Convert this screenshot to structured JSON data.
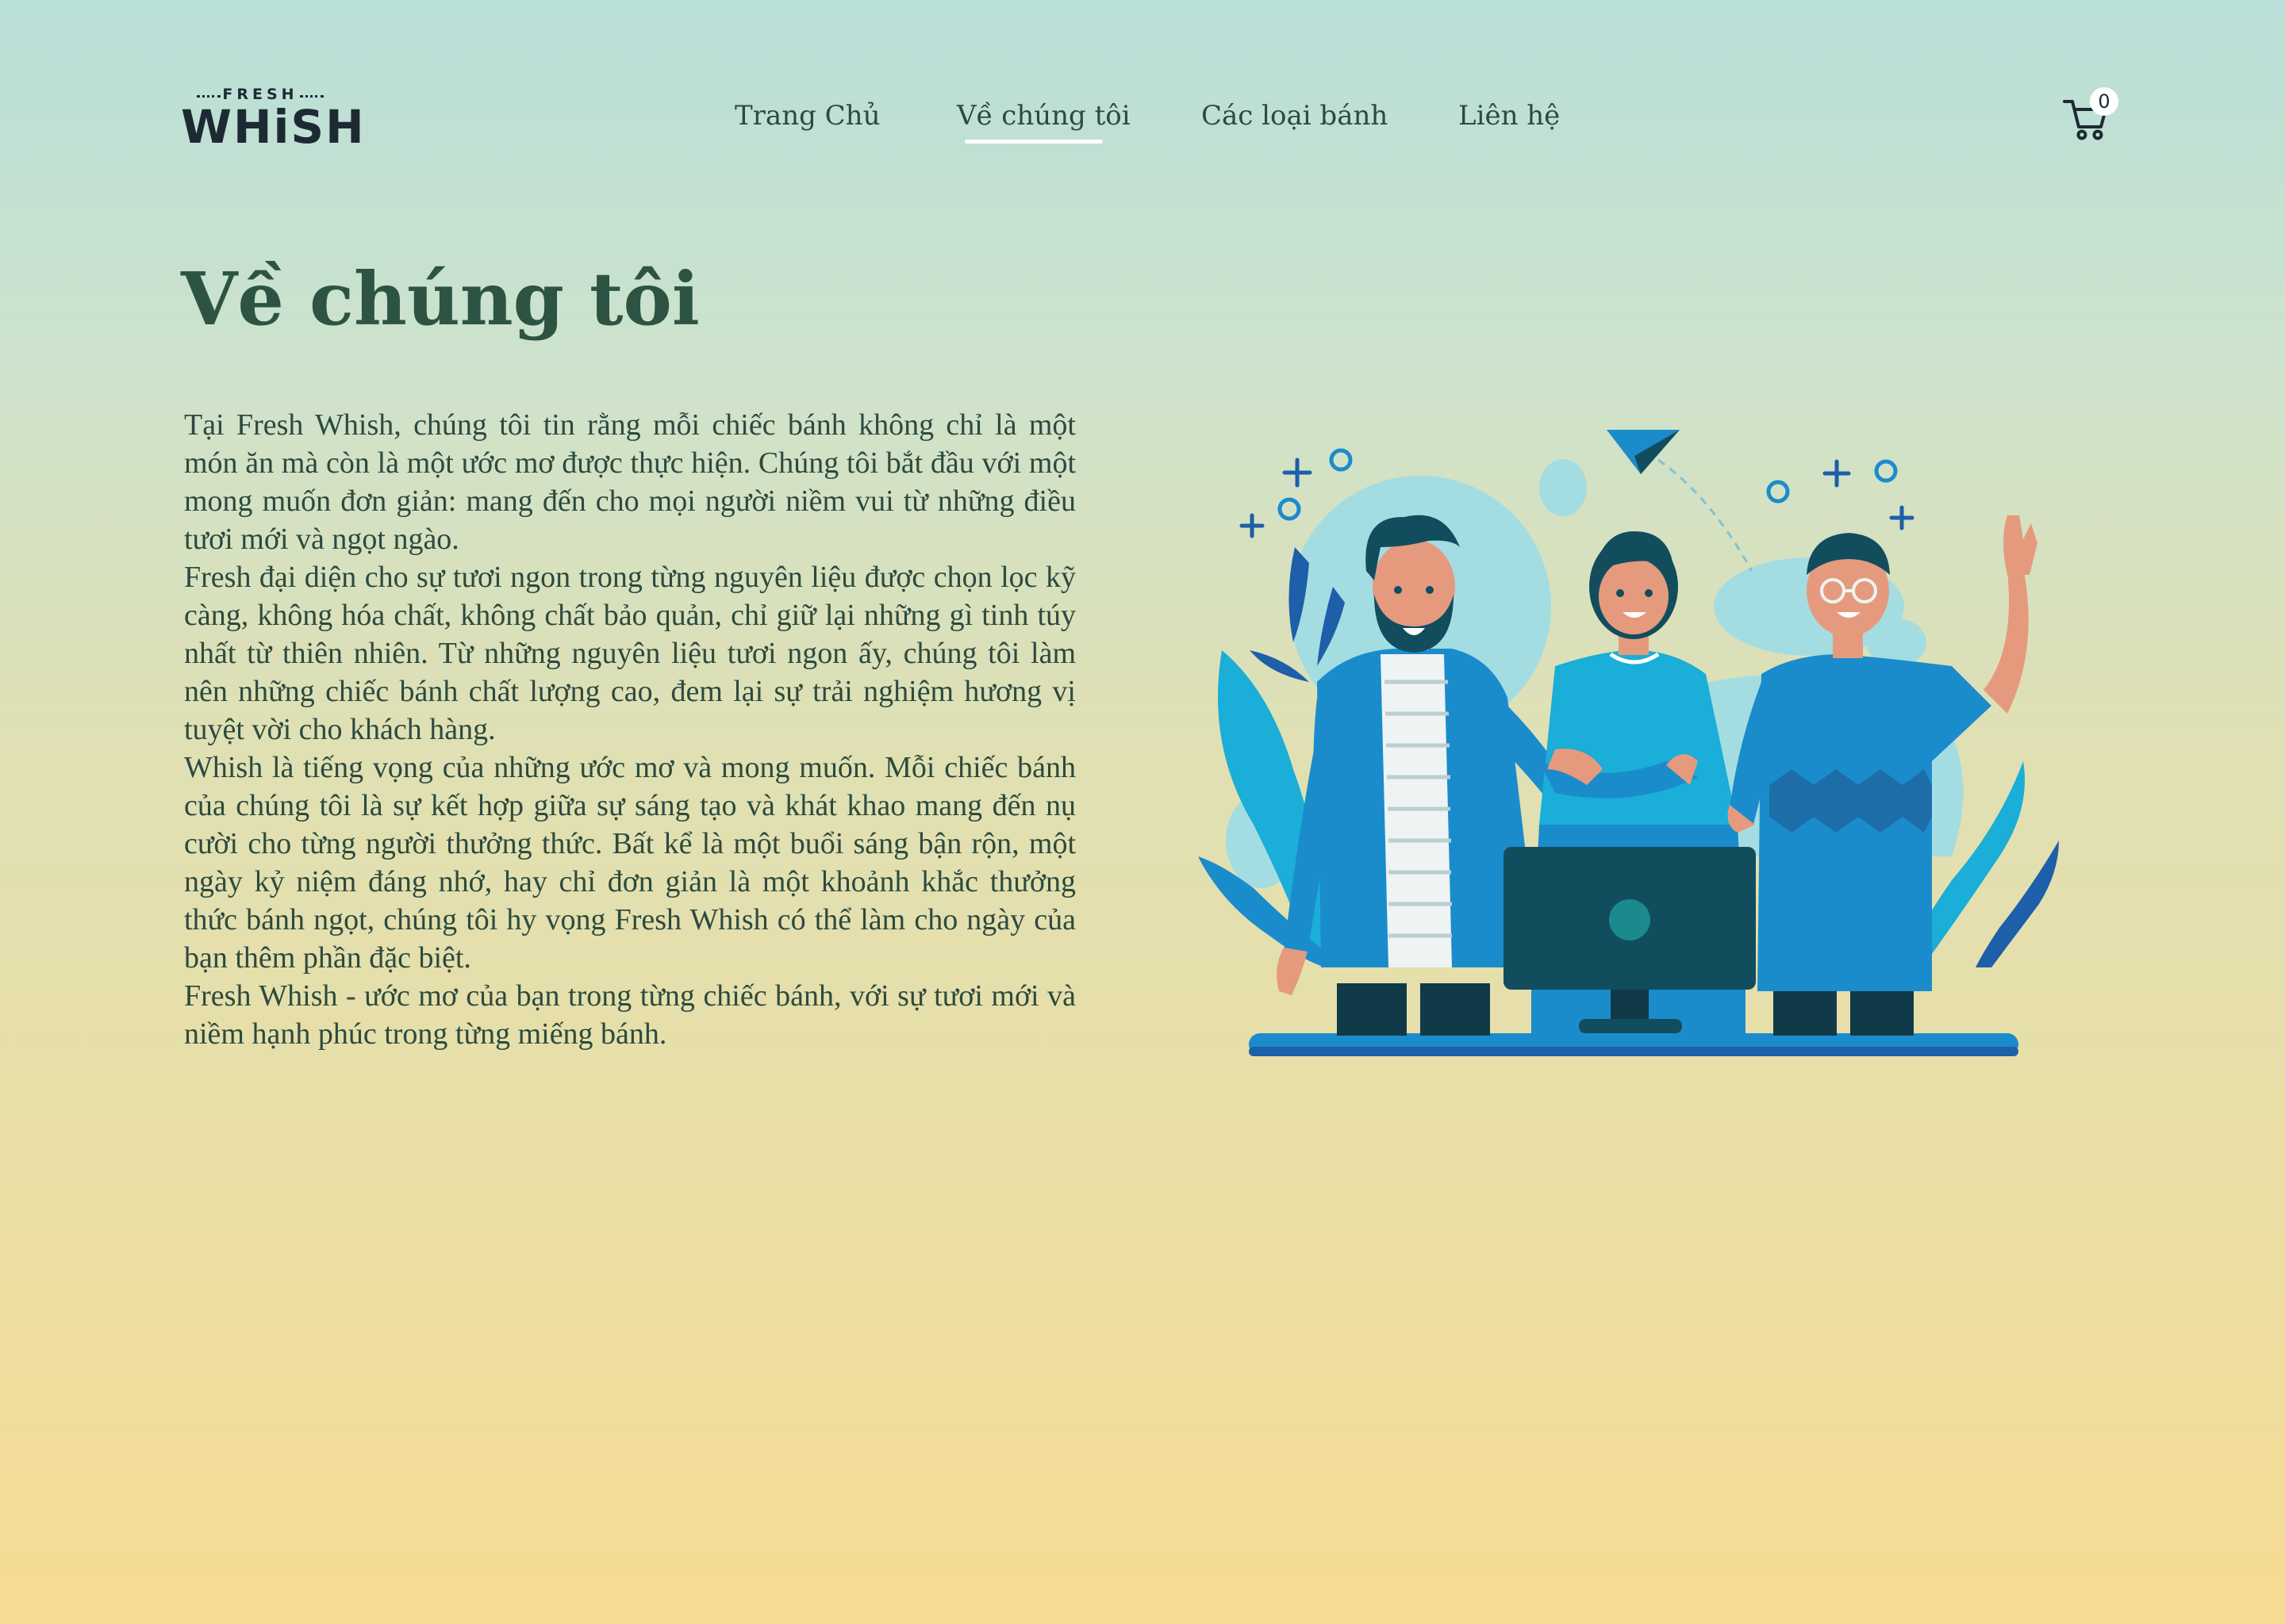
{
  "logo": {
    "small": "FRESH",
    "big": "WHiSH"
  },
  "nav": {
    "items": [
      {
        "label": "Trang Chủ"
      },
      {
        "label": "Về chúng tôi"
      },
      {
        "label": "Các loại bánh"
      },
      {
        "label": "Liên hệ"
      }
    ],
    "active_index": 1
  },
  "cart": {
    "count": "0",
    "icon": "shopping-cart-icon"
  },
  "main": {
    "title": "Về chúng tôi",
    "paragraphs": [
      "Tại Fresh Whish, chúng tôi tin rằng mỗi chiếc bánh không chỉ là một món ăn mà còn là một ước mơ được thực hiện. Chúng tôi bắt đầu với một mong muốn đơn giản: mang đến cho mọi người niềm vui từ những điều tươi mới và ngọt ngào.",
      "Fresh đại diện cho sự tươi ngon trong từng nguyên liệu được chọn lọc kỹ càng, không hóa chất, không chất bảo quản, chỉ giữ lại những gì tinh túy nhất từ thiên nhiên. Từ những nguyên liệu tươi ngon ấy, chúng tôi làm nên những chiếc bánh chất lượng cao, đem lại sự trải nghiệm hương vị tuyệt vời cho khách hàng.",
      "Whish là tiếng vọng của những ước mơ và mong muốn. Mỗi chiếc bánh của chúng tôi là sự kết hợp giữa sự sáng tạo và khát khao mang đến nụ cười cho từng người thưởng thức. Bất kể là một buổi sáng bận rộn, một ngày kỷ niệm đáng nhớ, hay chỉ đơn giản là một khoảnh khắc thưởng thức bánh ngọt, chúng tôi hy vọng Fresh Whish có thể làm cho ngày của bạn thêm phần đặc biệt.",
      "Fresh Whish - ước mơ của bạn trong từng chiếc bánh, với sự tươi mới và niềm hạnh phúc trong từng miếng bánh."
    ]
  },
  "colors": {
    "title": "#2d5443",
    "text": "#2c4a3f",
    "accent_blue": "#1a8ccc",
    "dark_teal": "#124d5e"
  }
}
